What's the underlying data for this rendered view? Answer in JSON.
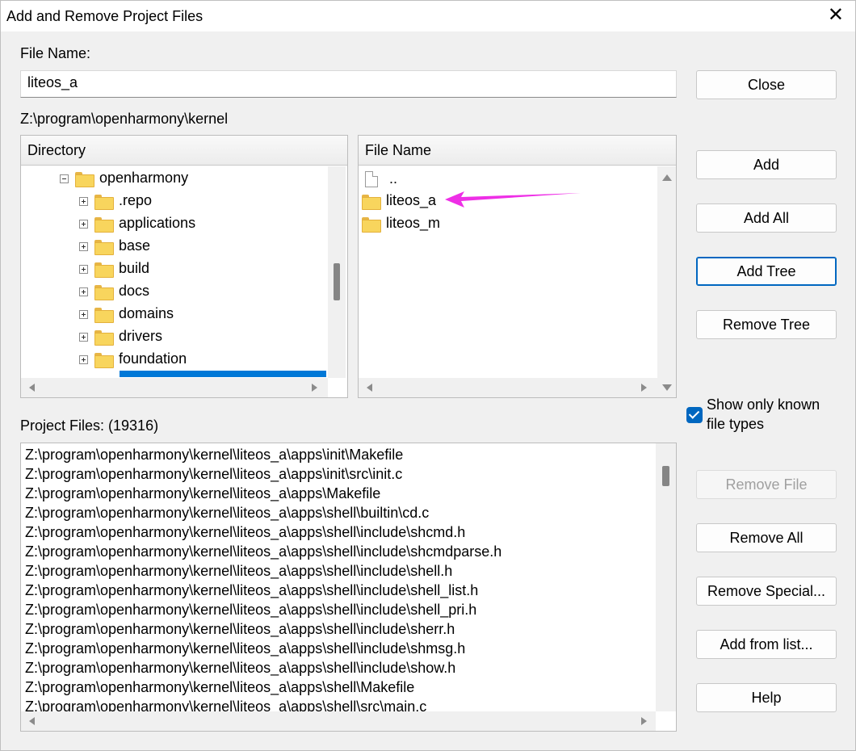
{
  "window": {
    "title": "Add and Remove Project Files"
  },
  "file_name": {
    "label": "File Name:",
    "value": "liteos_a"
  },
  "current_path": "Z:\\program\\openharmony\\kernel",
  "directory": {
    "header": "Directory",
    "root": "openharmony",
    "items": [
      ".repo",
      "applications",
      "base",
      "build",
      "docs",
      "domains",
      "drivers",
      "foundation"
    ]
  },
  "files": {
    "header": "File Name",
    "parent": "..",
    "items": [
      "liteos_a",
      "liteos_m"
    ],
    "annotation_color": "#ee2fe6"
  },
  "buttons": {
    "close": "Close",
    "add": "Add",
    "add_all": "Add All",
    "add_tree": "Add Tree",
    "remove_tree": "Remove Tree",
    "remove_file": "Remove File",
    "remove_all": "Remove All",
    "remove_special": "Remove Special...",
    "add_from_list": "Add from list...",
    "help": "Help"
  },
  "show_known": {
    "label_line1": "Show only known",
    "label_line2": "file types",
    "checked": true
  },
  "project": {
    "label": "Project Files: (19316)",
    "files": [
      "Z:\\program\\openharmony\\kernel\\liteos_a\\apps\\init\\Makefile",
      "Z:\\program\\openharmony\\kernel\\liteos_a\\apps\\init\\src\\init.c",
      "Z:\\program\\openharmony\\kernel\\liteos_a\\apps\\Makefile",
      "Z:\\program\\openharmony\\kernel\\liteos_a\\apps\\shell\\builtin\\cd.c",
      "Z:\\program\\openharmony\\kernel\\liteos_a\\apps\\shell\\include\\shcmd.h",
      "Z:\\program\\openharmony\\kernel\\liteos_a\\apps\\shell\\include\\shcmdparse.h",
      "Z:\\program\\openharmony\\kernel\\liteos_a\\apps\\shell\\include\\shell.h",
      "Z:\\program\\openharmony\\kernel\\liteos_a\\apps\\shell\\include\\shell_list.h",
      "Z:\\program\\openharmony\\kernel\\liteos_a\\apps\\shell\\include\\shell_pri.h",
      "Z:\\program\\openharmony\\kernel\\liteos_a\\apps\\shell\\include\\sherr.h",
      "Z:\\program\\openharmony\\kernel\\liteos_a\\apps\\shell\\include\\shmsg.h",
      "Z:\\program\\openharmony\\kernel\\liteos_a\\apps\\shell\\include\\show.h",
      "Z:\\program\\openharmony\\kernel\\liteos_a\\apps\\shell\\Makefile",
      "Z:\\program\\openharmony\\kernel\\liteos_a\\apps\\shell\\src\\main.c"
    ]
  }
}
